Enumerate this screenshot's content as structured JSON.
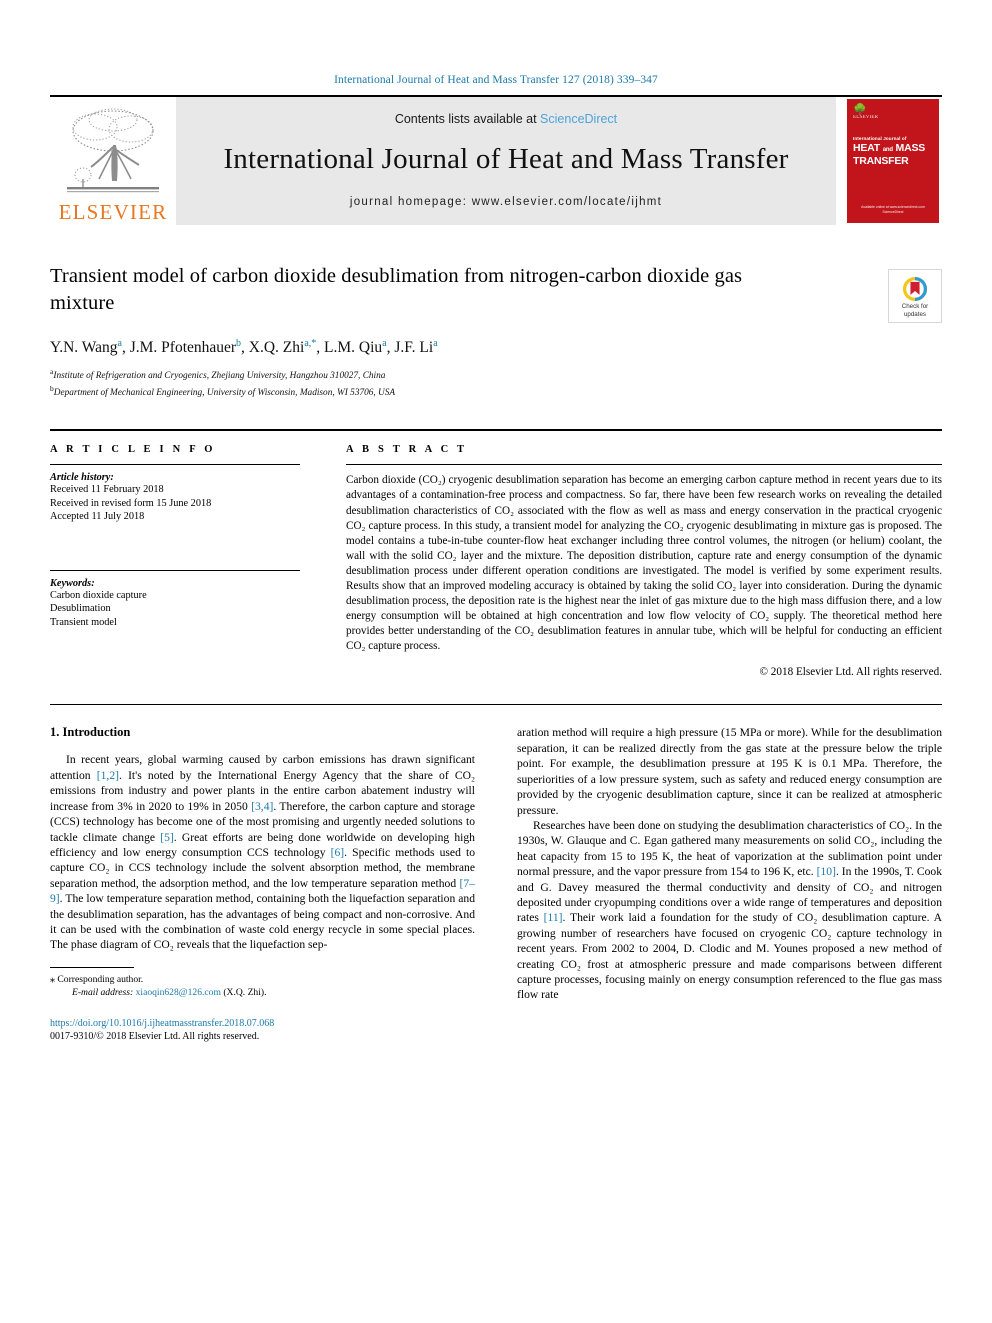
{
  "running_head": "International Journal of Heat and Mass Transfer 127 (2018) 339–347",
  "masthead": {
    "contents_prefix": "Contents lists available at ",
    "sciencedirect": "ScienceDirect",
    "journal_title": "International Journal of Heat and Mass Transfer",
    "homepage": "journal homepage: www.elsevier.com/locate/ijhmt",
    "publisher_logo_text": "ELSEVIER",
    "cover": {
      "publisher": "ELSEVIER",
      "kicker": "International Journal of",
      "line1": "HEAT",
      "line1_small": "and",
      "line1b": "MASS",
      "line2": "TRANSFER",
      "footer": "Available online at www.sciencedirect.com\nScienceDirect"
    }
  },
  "article": {
    "title": "Transient model of carbon dioxide desublimation from nitrogen-carbon dioxide gas mixture",
    "crossmark_label": "Check for\nupdates",
    "authors": [
      {
        "name": "Y.N. Wang",
        "marks": "a"
      },
      {
        "name": "J.M. Pfotenhauer",
        "marks": "b"
      },
      {
        "name": "X.Q. Zhi",
        "marks": "a,*"
      },
      {
        "name": "L.M. Qiu",
        "marks": "a"
      },
      {
        "name": "J.F. Li",
        "marks": "a"
      }
    ],
    "affiliations": [
      {
        "mark": "a",
        "text": "Institute of Refrigeration and Cryogenics, Zhejiang University, Hangzhou 310027, China"
      },
      {
        "mark": "b",
        "text": "Department of Mechanical Engineering, University of Wisconsin, Madison, WI 53706, USA"
      }
    ]
  },
  "article_info": {
    "heading": "A R T I C L E  I N F O",
    "history_title": "Article history:",
    "history": [
      "Received 11 February 2018",
      "Received in revised form 15 June 2018",
      "Accepted 11 July 2018"
    ],
    "keywords_title": "Keywords:",
    "keywords": [
      "Carbon dioxide capture",
      "Desublimation",
      "Transient model"
    ]
  },
  "abstract": {
    "heading": "A B S T R A C T",
    "text": "Carbon dioxide (CO₂) cryogenic desublimation separation has become an emerging carbon capture method in recent years due to its advantages of a contamination-free process and compactness. So far, there have been few research works on revealing the detailed desublimation characteristics of CO₂ associated with the flow as well as mass and energy conservation in the practical cryogenic CO₂ capture process. In this study, a transient model for analyzing the CO₂ cryogenic desublimating in mixture gas is proposed. The model contains a tube-in-tube counter-flow heat exchanger including three control volumes, the nitrogen (or helium) coolant, the wall with the solid CO₂ layer and the mixture. The deposition distribution, capture rate and energy consumption of the dynamic desublimation process under different operation conditions are investigated. The model is verified by some experiment results. Results show that an improved modeling accuracy is obtained by taking the solid CO₂ layer into consideration. During the dynamic desublimation process, the deposition rate is the highest near the inlet of gas mixture due to the high mass diffusion there, and a low energy consumption will be obtained at high concentration and low flow velocity of CO₂ supply. The theoretical method here provides better understanding of the CO₂ desublimation features in annular tube, which will be helpful for conducting an efficient CO₂ capture process.",
    "copyright": "© 2018 Elsevier Ltd. All rights reserved."
  },
  "body": {
    "section_heading": "1. Introduction",
    "left_paragraphs": [
      "In recent years, global warming caused by carbon emissions has drawn significant attention [1,2]. It's noted by the International Energy Agency that the share of CO₂ emissions from industry and power plants in the entire carbon abatement industry will increase from 3% in 2020 to 19% in 2050 [3,4]. Therefore, the carbon capture and storage (CCS) technology has become one of the most promising and urgently needed solutions to tackle climate change [5]. Great efforts are being done worldwide on developing high efficiency and low energy consumption CCS technology [6]. Specific methods used to capture CO₂ in CCS technology include the solvent absorption method, the membrane separation method, the adsorption method, and the low temperature separation method [7–9]. The low temperature separation method, containing both the liquefaction separation and the desublimation separation, has the advantages of being compact and non-corrosive. And it can be used with the combination of waste cold energy recycle in some special places. The phase diagram of CO₂ reveals that the liquefaction sep-"
    ],
    "right_paragraphs": [
      "aration method will require a high pressure (15 MPa or more). While for the desublimation separation, it can be realized directly from the gas state at the pressure below the triple point. For example, the desublimation pressure at 195 K is 0.1 MPa. Therefore, the superiorities of a low pressure system, such as safety and reduced energy consumption are provided by the cryogenic desublimation capture, since it can be realized at atmospheric pressure.",
      "Researches have been done on studying the desublimation characteristics of CO₂. In the 1930s, W. Glauque and C. Egan gathered many measurements on solid CO₂, including the heat capacity from 15 to 195 K, the heat of vaporization at the sublimation point under normal pressure, and the vapor pressure from 154 to 196 K, etc. [10]. In the 1990s, T. Cook and G. Davey measured the thermal conductivity and density of CO₂ and nitrogen deposited under cryopumping conditions over a wide range of temperatures and deposition rates [11]. Their work laid a foundation for the study of CO₂ desublimation capture. A growing number of researchers have focused on cryogenic CO₂ capture technology in recent years. From 2002 to 2004, D. Clodic and M. Younes proposed a new method of creating CO₂ frost at atmospheric pressure and made comparisons between different capture processes, focusing mainly on energy consumption referenced to the flue gas mass flow rate"
    ]
  },
  "footnote": {
    "corresponding_marker": "⁎",
    "corresponding_text": "Corresponding author.",
    "email_label": "E-mail address:",
    "email": "xiaoqin628@126.com",
    "email_owner": "(X.Q. Zhi)."
  },
  "doi": {
    "url": "https://doi.org/10.1016/j.ijheatmasstransfer.2018.07.068",
    "issn_line": "0017-9310/© 2018 Elsevier Ltd. All rights reserved."
  },
  "colors": {
    "link": "#1a7aa8",
    "elsevier_orange": "#E87722",
    "cover_red": "#c1151b",
    "masthead_bg": "#e8e8e8"
  }
}
